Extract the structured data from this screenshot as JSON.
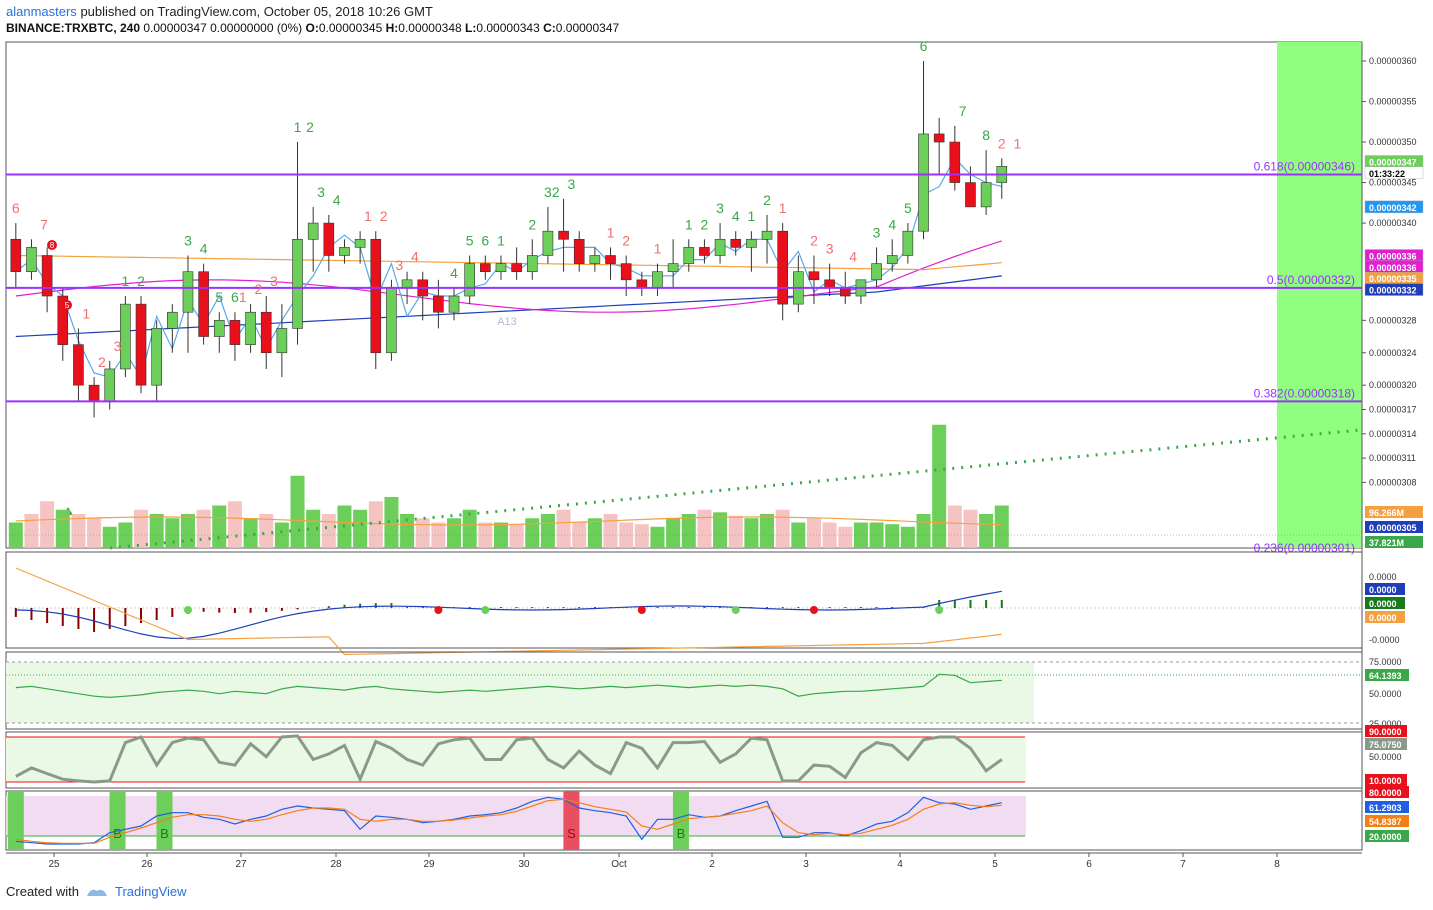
{
  "header": {
    "user": "alanmasters",
    "published": "published on TradingView.com, October 05, 2018 10:26 GMT",
    "symbol": "BINANCE:TRXBTC, 240",
    "price_change": "0.00000347 0.00000000 (0%)",
    "o_label": "O:",
    "o_value": "0.00000345",
    "h_label": "H:",
    "h_value": "0.00000348",
    "l_label": "L:",
    "l_value": "0.00000343",
    "c_label": "C:",
    "c_value": "0.00000347"
  },
  "footer": {
    "created_with": "Created with",
    "brand": "TradingView"
  },
  "colors": {
    "up": "#6ccf5a",
    "down": "#e8101a",
    "fib": "#9b30ff",
    "green_zone": "#90ff80",
    "ma_blue": "#1f3fb8",
    "ma_magenta": "#e020d0",
    "ma_orange": "#f5a040",
    "ma_light": "#5aa8e8"
  },
  "chart_data": {
    "type": "candlestick",
    "x_ticks": [
      "25",
      "26",
      "27",
      "28",
      "29",
      "30",
      "Oct",
      "2",
      "3",
      "4",
      "5",
      "6",
      "7",
      "8"
    ],
    "price_ticks": [
      "0.00000360",
      "0.00000355",
      "0.00000350",
      "0.00000345",
      "0.00000340",
      "0.00000328",
      "0.00000324",
      "0.00000320",
      "0.00000317",
      "0.00000314",
      "0.00000311",
      "0.00000308"
    ],
    "price_ticks_values": [
      360,
      355,
      350,
      345,
      340,
      328,
      324,
      320,
      317,
      314,
      311,
      308
    ],
    "ohlc_scaled_1e8": [
      [
        338,
        340,
        332,
        334
      ],
      [
        334,
        338,
        333,
        337
      ],
      [
        336,
        337,
        329,
        331
      ],
      [
        331,
        332,
        323,
        325
      ],
      [
        325,
        327,
        318,
        320
      ],
      [
        320,
        321,
        316,
        318
      ],
      [
        318,
        323,
        317,
        322
      ],
      [
        322,
        331,
        321,
        330
      ],
      [
        330,
        331,
        319,
        320
      ],
      [
        320,
        328,
        318,
        327
      ],
      [
        327,
        330,
        324,
        329
      ],
      [
        329,
        336,
        324,
        334
      ],
      [
        334,
        335,
        325,
        326
      ],
      [
        326,
        329,
        324,
        328
      ],
      [
        328,
        329,
        323,
        325
      ],
      [
        325,
        330,
        324,
        329
      ],
      [
        329,
        331,
        322,
        324
      ],
      [
        324,
        330,
        321,
        327
      ],
      [
        327,
        350,
        325,
        338
      ],
      [
        338,
        342,
        334,
        340
      ],
      [
        340,
        341,
        334,
        336
      ],
      [
        336,
        338,
        335,
        337
      ],
      [
        337,
        339,
        335,
        338
      ],
      [
        338,
        339,
        322,
        324
      ],
      [
        324,
        333,
        323,
        332
      ],
      [
        332,
        334,
        330,
        333
      ],
      [
        333,
        334,
        328,
        331
      ],
      [
        331,
        333,
        327,
        329
      ],
      [
        329,
        332,
        328,
        331
      ],
      [
        331,
        336,
        330,
        335
      ],
      [
        335,
        336,
        333,
        334
      ],
      [
        334,
        336,
        333,
        335
      ],
      [
        335,
        337,
        333,
        334
      ],
      [
        334,
        338,
        333,
        336
      ],
      [
        336,
        342,
        335,
        339
      ],
      [
        339,
        343,
        334,
        338
      ],
      [
        338,
        339,
        334,
        335
      ],
      [
        335,
        337,
        334,
        336
      ],
      [
        336,
        337,
        333,
        335
      ],
      [
        335,
        336,
        331,
        333
      ],
      [
        333,
        334,
        331,
        332
      ],
      [
        332,
        335,
        331,
        334
      ],
      [
        334,
        338,
        332,
        335
      ],
      [
        335,
        338,
        334,
        337
      ],
      [
        337,
        338,
        335,
        336
      ],
      [
        336,
        340,
        335,
        338
      ],
      [
        338,
        339,
        336,
        337
      ],
      [
        337,
        339,
        334,
        338
      ],
      [
        338,
        341,
        335,
        339
      ],
      [
        339,
        340,
        328,
        330
      ],
      [
        330,
        336,
        329,
        334
      ],
      [
        334,
        336,
        330,
        333
      ],
      [
        333,
        335,
        331,
        332
      ],
      [
        332,
        334,
        330,
        331
      ],
      [
        331,
        333,
        330,
        333
      ],
      [
        333,
        337,
        332,
        335
      ],
      [
        335,
        338,
        334,
        336
      ],
      [
        336,
        340,
        335,
        339
      ],
      [
        339,
        360,
        338,
        351
      ],
      [
        351,
        353,
        346,
        350
      ],
      [
        350,
        352,
        344,
        345
      ],
      [
        345,
        347,
        342,
        342
      ],
      [
        342,
        349,
        341,
        345
      ],
      [
        345,
        348,
        343,
        347
      ]
    ],
    "fib_levels": [
      {
        "label": "0.618(0.00000346)",
        "price": 346
      },
      {
        "label": "0.5(0.00000332)",
        "price": 332
      },
      {
        "label": "0.382(0.00000318)",
        "price": 318
      }
    ],
    "fib_partial_label": "0.236(0.00000301)",
    "price_tags": [
      {
        "text": "0.00000347",
        "price": 347.6,
        "color": "#6ccf5a"
      },
      {
        "text": "01:33:22",
        "price": 346.2,
        "color": "#ffffff"
      },
      {
        "text": "0.00000342",
        "price": 342,
        "color": "#2196f3"
      },
      {
        "text": "0.00000336",
        "price": 336,
        "color": "#e020d0"
      },
      {
        "text": "0.00000336",
        "price": 334.6,
        "color": "#e020d0"
      },
      {
        "text": "0.00000335",
        "price": 333.2,
        "color": "#f5a040"
      },
      {
        "text": "0.00000332",
        "price": 331.8,
        "color": "#1f3fb8"
      }
    ],
    "volume_tags": [
      "96.266M",
      "0.00000305",
      "37.821M"
    ],
    "td_labels_up": [
      "1",
      "2",
      "3",
      "4",
      "5",
      "6",
      "1",
      "2",
      "3",
      "4",
      "2",
      "3",
      "4",
      "5",
      "6",
      "1",
      "2",
      "3",
      "1",
      "2",
      "3",
      "4",
      "1",
      "2",
      "3",
      "4",
      "5",
      "6",
      "7",
      "8"
    ],
    "td_labels_down": [
      "6",
      "7",
      "1",
      "2",
      "3",
      "1",
      "2",
      "3",
      "1",
      "2",
      "3",
      "4",
      "1",
      "2",
      "1",
      "1",
      "2",
      "3",
      "4",
      "1",
      "2"
    ],
    "td_label_annotation": "A13",
    "signal_markers": [
      "8",
      "5"
    ],
    "macd_ticks": [
      "0.0000",
      "-0.0000"
    ],
    "macd_tags": [
      "0.0000",
      "0.0000",
      "0.0000"
    ],
    "rsi_ticks": [
      "75.0000",
      "50.0000",
      "25.0000"
    ],
    "rsi_tag": "64.1393",
    "stoch_ticks": [
      "90.0000",
      "50.0000"
    ],
    "stoch_tags": [
      "75.0750",
      "10.0000"
    ],
    "srsi_tags": [
      "80.0000",
      "61.2903",
      "54.8387",
      "20.0000"
    ],
    "srsi_markers": [
      "B",
      "B",
      "S",
      "B"
    ],
    "rsi_values": [
      69,
      70,
      68,
      66,
      64,
      62,
      61,
      62,
      63,
      65,
      66,
      67,
      66,
      64,
      66,
      65,
      64,
      68,
      70,
      69,
      68,
      67,
      69,
      70,
      68,
      67,
      66,
      65,
      66,
      67,
      66,
      67,
      68,
      69,
      70,
      69,
      68,
      69,
      70,
      69,
      70,
      71,
      70,
      69,
      70,
      71,
      70,
      71,
      70,
      68,
      62,
      64,
      65,
      66,
      66,
      67,
      68,
      69,
      70,
      80,
      79,
      73,
      74,
      75
    ],
    "stoch_values": [
      20,
      35,
      25,
      15,
      12,
      10,
      12,
      80,
      90,
      40,
      80,
      88,
      85,
      45,
      40,
      78,
      55,
      90,
      92,
      50,
      60,
      75,
      15,
      82,
      70,
      50,
      40,
      78,
      85,
      88,
      50,
      50,
      85,
      88,
      50,
      35,
      65,
      40,
      25,
      80,
      70,
      35,
      80,
      80,
      82,
      45,
      60,
      88,
      85,
      12,
      12,
      40,
      38,
      18,
      62,
      80,
      75,
      50,
      85,
      90,
      90,
      70,
      30,
      50,
      75
    ],
    "srsi_k": [
      12,
      10,
      8,
      8,
      8,
      10,
      25,
      30,
      35,
      50,
      55,
      55,
      48,
      45,
      38,
      45,
      50,
      60,
      65,
      62,
      60,
      58,
      30,
      50,
      48,
      45,
      40,
      42,
      45,
      50,
      52,
      55,
      62,
      72,
      78,
      75,
      62,
      58,
      55,
      50,
      15,
      45,
      45,
      52,
      48,
      50,
      58,
      65,
      72,
      18,
      18,
      25,
      25,
      20,
      28,
      38,
      42,
      55,
      78,
      70,
      68,
      60,
      65,
      70
    ],
    "srsi_d": [
      15,
      12,
      10,
      9,
      9,
      9,
      18,
      25,
      32,
      40,
      48,
      52,
      52,
      50,
      45,
      42,
      45,
      52,
      58,
      62,
      62,
      60,
      45,
      42,
      45,
      45,
      42,
      42,
      44,
      47,
      50,
      52,
      57,
      65,
      73,
      75,
      70,
      64,
      60,
      56,
      35,
      30,
      38,
      46,
      48,
      50,
      54,
      58,
      65,
      40,
      25,
      22,
      24,
      22,
      24,
      30,
      36,
      45,
      60,
      68,
      70,
      66,
      64,
      66
    ],
    "volume_values": [
      30,
      40,
      55,
      45,
      40,
      35,
      25,
      30,
      45,
      40,
      35,
      40,
      45,
      50,
      55,
      35,
      40,
      30,
      85,
      45,
      40,
      50,
      45,
      55,
      60,
      40,
      35,
      30,
      35,
      45,
      30,
      30,
      28,
      35,
      40,
      45,
      30,
      35,
      40,
      30,
      28,
      25,
      35,
      40,
      45,
      42,
      38,
      35,
      40,
      45,
      30,
      35,
      30,
      25,
      30,
      30,
      28,
      25,
      40,
      145,
      50,
      45,
      40,
      50,
      20
    ],
    "volume_up": [
      true,
      false,
      false,
      true,
      false,
      false,
      true,
      true,
      false,
      true,
      true,
      true,
      false,
      true,
      false,
      true,
      false,
      true,
      true,
      true,
      false,
      true,
      true,
      false,
      true,
      true,
      false,
      false,
      true,
      true,
      false,
      true,
      false,
      true,
      true,
      false,
      false,
      true,
      false,
      false,
      false,
      true,
      true,
      true,
      false,
      true,
      false,
      true,
      true,
      false,
      true,
      false,
      false,
      false,
      true,
      true,
      true,
      true,
      true,
      true,
      false,
      false,
      true,
      true
    ]
  }
}
